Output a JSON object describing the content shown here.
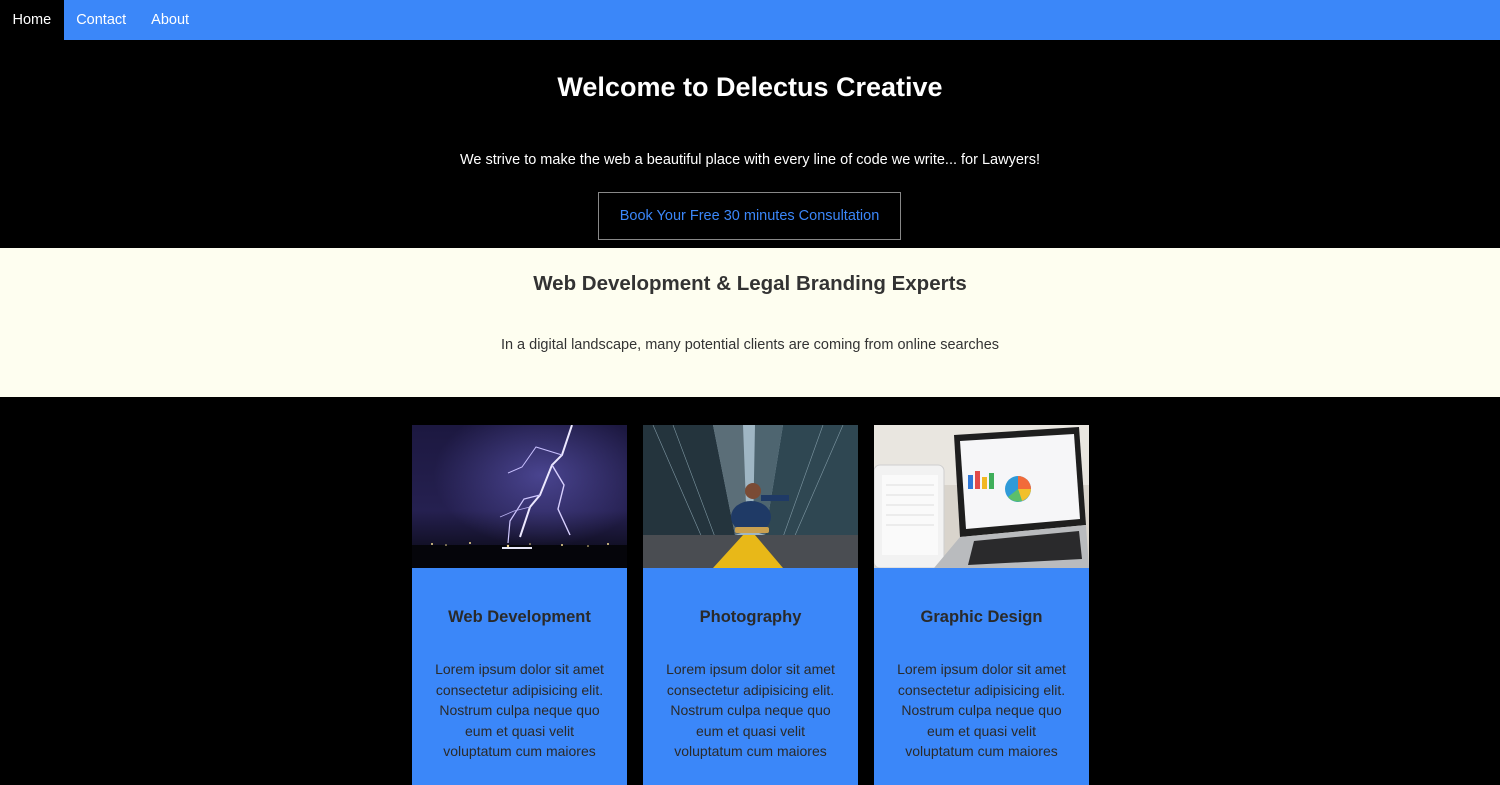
{
  "nav": {
    "items": [
      {
        "label": "Home",
        "active": true
      },
      {
        "label": "Contact",
        "active": false
      },
      {
        "label": "About",
        "active": false
      }
    ]
  },
  "hero": {
    "title": "Welcome to Delectus Creative",
    "tagline": "We strive to make the web a beautiful place with every line of code we write... for Lawyers!",
    "cta_label": "Book Your Free 30 minutes Consultation"
  },
  "brand": {
    "heading": "Web Development & Legal Branding Experts",
    "text": "In a digital landscape, many potential clients are coming from online searches"
  },
  "services": [
    {
      "title": "Web Development",
      "text": "Lorem ipsum dolor sit amet consectetur adipisicing elit. Nostrum culpa neque quo eum et quasi velit voluptatum cum maiores",
      "image": "lightning-storm-photo"
    },
    {
      "title": "Photography",
      "text": "Lorem ipsum dolor sit amet consectetur adipisicing elit. Nostrum culpa neque quo eum et quasi velit voluptatum cum maiores",
      "image": "city-skateboarder-photo"
    },
    {
      "title": "Graphic Design",
      "text": "Lorem ipsum dolor sit amet consectetur adipisicing elit. Nostrum culpa neque quo eum et quasi velit voluptatum cum maiores",
      "image": "laptop-tablet-charts-photo"
    }
  ],
  "colors": {
    "accent": "#3b87f9",
    "hero_bg": "#000000",
    "brand_bg": "#fefef0"
  }
}
